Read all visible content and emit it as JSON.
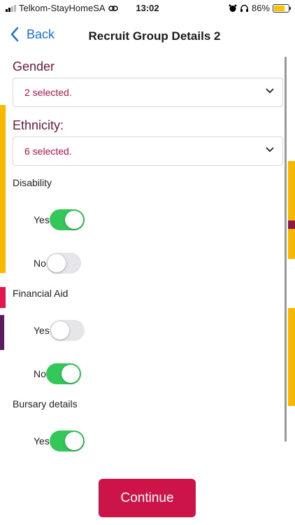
{
  "status_bar": {
    "carrier": "Telkom-StayHomeSA",
    "time": "13:02",
    "battery": "86%",
    "battery_level": 0.86
  },
  "nav": {
    "back_label": "Back",
    "title": "Recruit Group Details 2"
  },
  "gender": {
    "label": "Gender",
    "value": "2 selected."
  },
  "ethnicity": {
    "label": "Ethnicity:",
    "value": "6 selected."
  },
  "disability": {
    "label": "Disability",
    "yes_label": "Yes",
    "yes_on": true,
    "no_label": "No",
    "no_on": false
  },
  "financial_aid": {
    "label": "Financial Aid",
    "yes_label": "Yes",
    "yes_on": false,
    "no_label": "No",
    "no_on": true
  },
  "bursary": {
    "label": "Bursary details",
    "yes_label": "Yes",
    "yes_on": true
  },
  "continue_label": "Continue",
  "colors": {
    "accent": "#cc1448",
    "link": "#1a73d9",
    "toggle_on": "#34c759",
    "label_maroon": "#6b1a3b"
  }
}
